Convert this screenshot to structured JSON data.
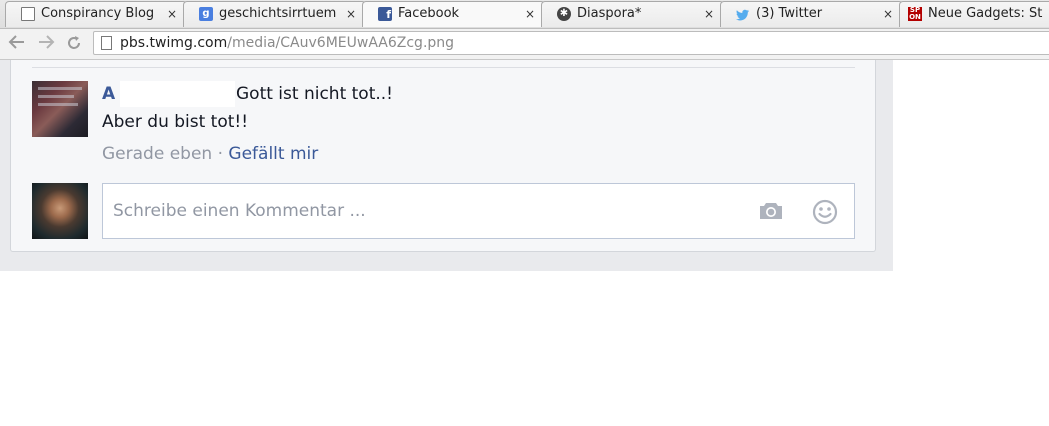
{
  "tabs": [
    {
      "title": "Conspirancy Blog | ",
      "icon": "document-icon"
    },
    {
      "title": "geschichtsirrtuem",
      "icon": "google-icon"
    },
    {
      "title": "Facebook",
      "icon": "facebook-icon"
    },
    {
      "title": "Diaspora*",
      "icon": "diaspora-icon"
    },
    {
      "title": "(3) Twitter",
      "icon": "twitter-icon"
    },
    {
      "title": "Neue Gadgets: St",
      "icon": "spiegel-online-icon"
    }
  ],
  "tab_close_glyph": "×",
  "address": {
    "host": "pbs.twimg.com",
    "path": "/media/CAuv6MEUwAA6Zcg.png"
  },
  "comment": {
    "author_visible": "A",
    "line1": "Gott ist nicht tot..!",
    "line2": "Aber du bist tot!!",
    "time": "Gerade eben",
    "separator": " · ",
    "like": "Gefällt mir"
  },
  "composer": {
    "placeholder": "Schreibe einen Kommentar ..."
  },
  "colors": {
    "facebook_blue": "#3b5998",
    "meta_gray": "#9197a3",
    "page_bg": "#e9eaed",
    "card_bg": "#f6f7f9"
  }
}
